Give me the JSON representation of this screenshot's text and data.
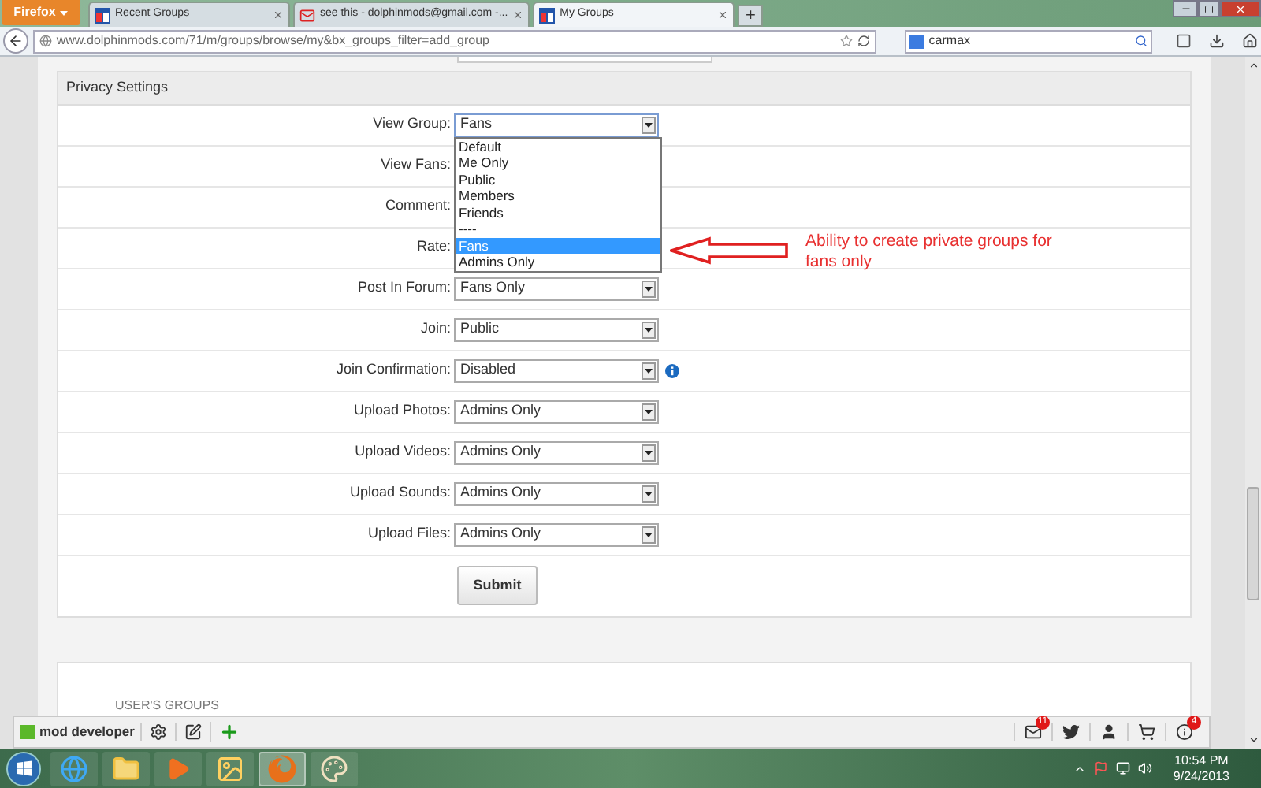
{
  "browser": {
    "menu_button": "Firefox",
    "tabs": [
      {
        "title": "Recent Groups",
        "kind": "site",
        "selected": false
      },
      {
        "title": "see this - dolphinmods@gmail.com -...",
        "kind": "mail",
        "selected": false
      },
      {
        "title": "My Groups",
        "kind": "site",
        "selected": true
      }
    ],
    "new_tab": "+",
    "url": "www.dolphinmods.com/71/m/groups/browse/my&bx_groups_filter=add_group",
    "search": "carmax"
  },
  "privacy": {
    "title": "Privacy Settings",
    "fields": [
      {
        "label": "View Group:",
        "value": "Fans",
        "expanded": true,
        "info": false
      },
      {
        "label": "View Fans:",
        "info": false
      },
      {
        "label": "Comment:",
        "info": false
      },
      {
        "label": "Rate:",
        "info": false
      },
      {
        "label": "Post In Forum:",
        "value": "Fans Only",
        "expanded": false,
        "info": false
      },
      {
        "label": "Join:",
        "value": "Public",
        "expanded": false,
        "info": false
      },
      {
        "label": "Join Confirmation:",
        "value": "Disabled",
        "expanded": false,
        "info": true
      },
      {
        "label": "Upload Photos:",
        "value": "Admins Only",
        "expanded": false,
        "info": false
      },
      {
        "label": "Upload Videos:",
        "value": "Admins Only",
        "expanded": false,
        "info": false
      },
      {
        "label": "Upload Sounds:",
        "value": "Admins Only",
        "expanded": false,
        "info": false
      },
      {
        "label": "Upload Files:",
        "value": "Admins Only",
        "expanded": false,
        "info": false
      }
    ],
    "options": [
      {
        "label": "Default",
        "selected": false
      },
      {
        "label": "Me Only",
        "selected": false
      },
      {
        "label": "Public",
        "selected": false
      },
      {
        "label": "Members",
        "selected": false
      },
      {
        "label": "Friends",
        "selected": false
      },
      {
        "label": "----",
        "selected": false
      },
      {
        "label": "Fans",
        "selected": true
      },
      {
        "label": "Admins Only",
        "selected": false
      }
    ],
    "submit": "Submit"
  },
  "annotation": "Ability to create private groups for fans only",
  "users_groups": {
    "title": "USER'S GROUPS"
  },
  "toolbar": {
    "user": "mod developer",
    "left": [
      {
        "kind": "settings"
      },
      {
        "kind": "edit"
      },
      {
        "kind": "add"
      }
    ],
    "right": [
      {
        "kind": "mail",
        "badge": "11"
      },
      {
        "kind": "bird"
      },
      {
        "kind": "person"
      },
      {
        "kind": "cart"
      },
      {
        "kind": "info",
        "badge": "4"
      }
    ]
  },
  "taskbar": {
    "apps": [
      {
        "kind": "globe"
      },
      {
        "kind": "folder"
      },
      {
        "kind": "play"
      },
      {
        "kind": "picture"
      },
      {
        "kind": "fox",
        "selected": true
      },
      {
        "kind": "palette"
      }
    ],
    "time": "10:54 PM",
    "date": "9/24/2013"
  }
}
